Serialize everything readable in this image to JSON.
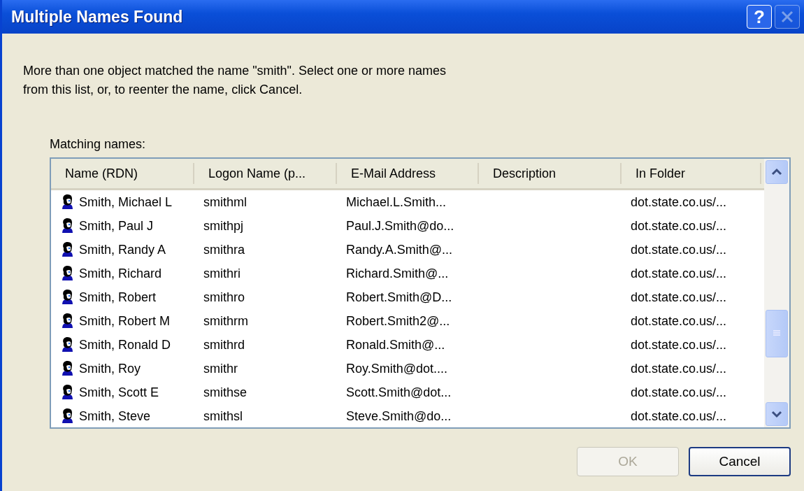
{
  "window": {
    "title": "Multiple Names Found",
    "help_button": "?",
    "close_button": {
      "disabled": true
    }
  },
  "message": "More than one object matched the name \"smith\".  Select one or more names\nfrom this list, or, to reenter the name, click Cancel.",
  "list_label": "Matching names:",
  "table": {
    "columns": [
      "Name (RDN)",
      "Logon Name (p...",
      "E-Mail Address",
      "Description",
      "In Folder"
    ],
    "rows": [
      {
        "name": "Smith, Michael L",
        "logon": "smithml",
        "email": "Michael.L.Smith...",
        "folder": "dot.state.co.us/..."
      },
      {
        "name": "Smith, Paul J",
        "logon": "smithpj",
        "email": "Paul.J.Smith@do...",
        "folder": "dot.state.co.us/..."
      },
      {
        "name": "Smith, Randy A",
        "logon": "smithra",
        "email": "Randy.A.Smith@...",
        "folder": "dot.state.co.us/..."
      },
      {
        "name": "Smith, Richard",
        "logon": "smithri",
        "email": "Richard.Smith@...",
        "folder": "dot.state.co.us/..."
      },
      {
        "name": "Smith, Robert",
        "logon": "smithro",
        "email": "Robert.Smith@D...",
        "folder": "dot.state.co.us/..."
      },
      {
        "name": "Smith, Robert M",
        "logon": "smithrm",
        "email": "Robert.Smith2@...",
        "folder": "dot.state.co.us/..."
      },
      {
        "name": "Smith, Ronald D",
        "logon": "smithrd",
        "email": "Ronald.Smith@...",
        "folder": "dot.state.co.us/..."
      },
      {
        "name": "Smith, Roy",
        "logon": "smithr",
        "email": "Roy.Smith@dot....",
        "folder": "dot.state.co.us/..."
      },
      {
        "name": "Smith, Scott E",
        "logon": "smithse",
        "email": "Scott.Smith@dot...",
        "folder": "dot.state.co.us/..."
      },
      {
        "name": "Smith, Steve",
        "logon": "smithsl",
        "email": "Steve.Smith@do...",
        "folder": "dot.state.co.us/..."
      }
    ]
  },
  "buttons": [
    {
      "label": "OK",
      "disabled": true
    },
    {
      "label": "Cancel",
      "disabled": false
    }
  ]
}
